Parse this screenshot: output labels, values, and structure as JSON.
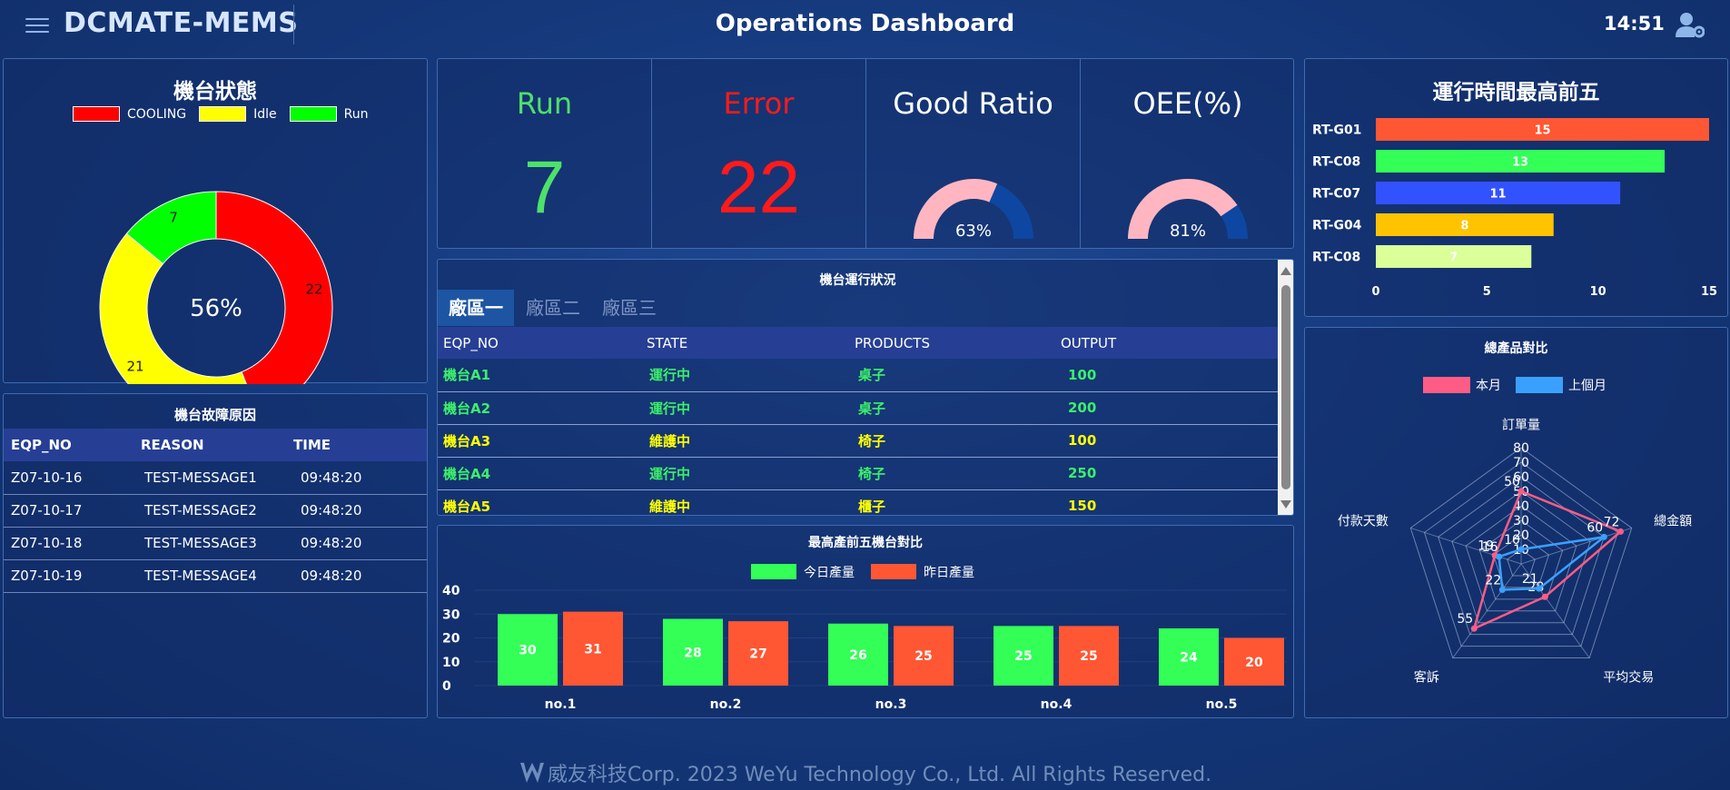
{
  "header": {
    "brand": "DCMATE-MEMS",
    "title": "Operations Dashboard",
    "time": "14:51"
  },
  "status_panel": {
    "title": "機台狀態",
    "center_label": "56%",
    "legend": [
      {
        "name": "COOLING",
        "color": "#ff0000"
      },
      {
        "name": "Idle",
        "color": "#ffff00"
      },
      {
        "name": "Run",
        "color": "#00ff00"
      }
    ],
    "slices": [
      {
        "name": "COOLING",
        "value": 22,
        "label": "22",
        "color": "#ff0000"
      },
      {
        "name": "Idle",
        "value": 21,
        "label": "21",
        "color": "#ffff00"
      },
      {
        "name": "Run",
        "value": 7,
        "label": "7",
        "color": "#00ff00"
      }
    ]
  },
  "kpis": {
    "run": {
      "label": "Run",
      "value": "7",
      "color": "#4ee06a"
    },
    "error": {
      "label": "Error",
      "value": "22",
      "color": "#ff1a1a"
    },
    "good_ratio": {
      "label": "Good Ratio",
      "value": 63,
      "display": "63%"
    },
    "oee": {
      "label": "OEE(%)",
      "value": 81,
      "display": "81%"
    }
  },
  "runtime_panel": {
    "title": "運行時間最高前五",
    "bars": [
      {
        "name": "RT-G01",
        "value": 15,
        "label": "15",
        "color": "#ff5733"
      },
      {
        "name": "RT-C08",
        "value": 13,
        "label": "13",
        "color": "#33ff57"
      },
      {
        "name": "RT-C07",
        "value": 11,
        "label": "11",
        "color": "#3352ff"
      },
      {
        "name": "RT-G04",
        "value": 8,
        "label": "8",
        "color": "#ffc300"
      },
      {
        "name": "RT-C08",
        "value": 7,
        "label": "7",
        "color": "#dbff99"
      }
    ],
    "ticks": [
      "0",
      "5",
      "10",
      "15"
    ],
    "max": 15
  },
  "fault_panel": {
    "title": "機台故障原因",
    "headers": [
      "EQP_NO",
      "REASON",
      "TIME"
    ],
    "rows": [
      {
        "eqp": "Z07-10-16",
        "reason": "TEST-MESSAGE1",
        "time": "09:48:20"
      },
      {
        "eqp": "Z07-10-17",
        "reason": "TEST-MESSAGE2",
        "time": "09:48:20"
      },
      {
        "eqp": "Z07-10-18",
        "reason": "TEST-MESSAGE3",
        "time": "09:48:20"
      },
      {
        "eqp": "Z07-10-19",
        "reason": "TEST-MESSAGE4",
        "time": "09:48:20"
      }
    ]
  },
  "run_panel": {
    "title": "機台運行狀況",
    "tabs": [
      "廠區一",
      "廠區二",
      "廠區三"
    ],
    "headers": [
      "EQP_NO",
      "STATE",
      "PRODUCTS",
      "OUTPUT"
    ],
    "rows": [
      {
        "eqp": "機台A1",
        "state": "運行中",
        "product": "桌子",
        "output": "100",
        "color": "#3cf06a"
      },
      {
        "eqp": "機台A2",
        "state": "運行中",
        "product": "桌子",
        "output": "200",
        "color": "#3cf06a"
      },
      {
        "eqp": "機台A3",
        "state": "維護中",
        "product": "椅子",
        "output": "100",
        "color": "#ffff00"
      },
      {
        "eqp": "機台A4",
        "state": "運行中",
        "product": "椅子",
        "output": "250",
        "color": "#3cf06a"
      },
      {
        "eqp": "機台A5",
        "state": "維護中",
        "product": "櫃子",
        "output": "150",
        "color": "#ffff00"
      }
    ]
  },
  "top5_panel": {
    "title": "最高產前五機台對比"
  },
  "radar_panel": {
    "title": "總產品對比"
  },
  "chart_data": [
    {
      "type": "pie",
      "title": "機台狀態",
      "categories": [
        "COOLING",
        "Idle",
        "Run"
      ],
      "values": [
        22,
        21,
        7
      ]
    },
    {
      "type": "bar",
      "title": "運行時間最高前五",
      "categories": [
        "RT-G01",
        "RT-C08",
        "RT-C07",
        "RT-G04",
        "RT-C08"
      ],
      "values": [
        15,
        13,
        11,
        8,
        7
      ],
      "xlim": [
        0,
        15
      ]
    },
    {
      "type": "bar",
      "title": "最高產前五機台對比",
      "categories": [
        "no.1",
        "no.2",
        "no.3",
        "no.4",
        "no.5"
      ],
      "series": [
        {
          "name": "今日產量",
          "values": [
            30,
            28,
            26,
            25,
            24
          ],
          "color": "#33ff57"
        },
        {
          "name": "昨日產量",
          "values": [
            31,
            27,
            25,
            25,
            20
          ],
          "color": "#ff5733"
        }
      ],
      "ylim": [
        0,
        40
      ],
      "yticks": [
        "0",
        "10",
        "20",
        "30",
        "40"
      ]
    },
    {
      "type": "radar",
      "title": "總產品對比",
      "categories": [
        "訂單量",
        "總金額",
        "平均交易",
        "客訴",
        "付款天數"
      ],
      "rmax": 80,
      "rticks": [
        "10",
        "20",
        "30",
        "40",
        "50",
        "60",
        "70",
        "80"
      ],
      "series": [
        {
          "name": "本月",
          "values": [
            50,
            72,
            28,
            55,
            19
          ],
          "color": "#ff5c85"
        },
        {
          "name": "上個月",
          "values": [
            10,
            60,
            21,
            22,
            16
          ],
          "color": "#3aa0ff"
        }
      ]
    }
  ],
  "footer": {
    "text": "威友科技Corp. 2023 WeYu Technology Co., Ltd. All Rights Reserved."
  }
}
